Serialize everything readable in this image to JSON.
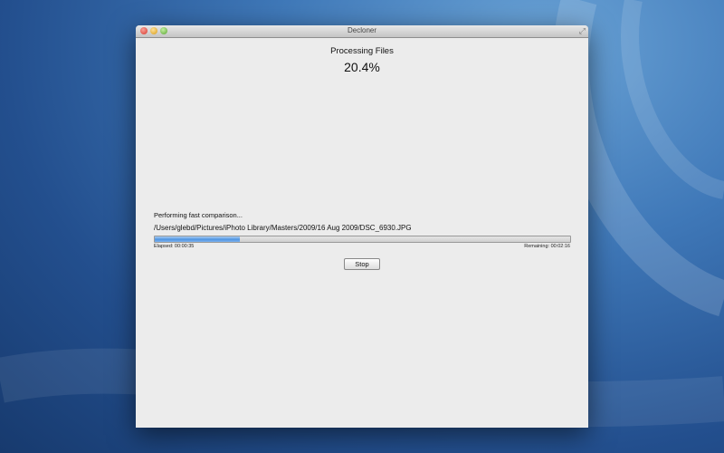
{
  "window": {
    "title": "Decloner"
  },
  "main": {
    "heading": "Processing Files",
    "percent": "20.4%",
    "status": "Performing fast comparison...",
    "current_file": "/Users/glebd/Pictures/iPhoto Library/Masters/2009/16 Aug 2009/DSC_6930.JPG",
    "progress": {
      "fraction": 0.204
    },
    "elapsed": "Elapsed: 00:00:35",
    "remaining": "Remaining: 00:02:16",
    "stop_label": "Stop"
  },
  "colors": {
    "progress_fill": "#4f95e2",
    "window_bg": "#ececec"
  }
}
